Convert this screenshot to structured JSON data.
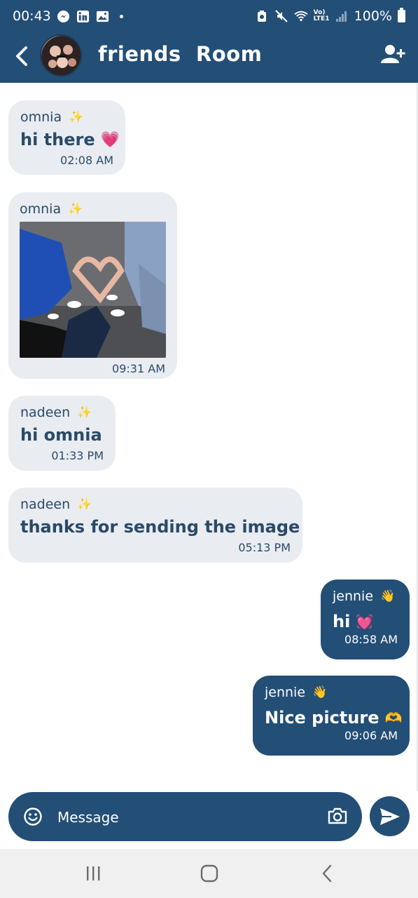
{
  "status_bar": {
    "time": "00:43",
    "battery": "100%",
    "network": "Vo) LTE1",
    "icons": [
      "messenger-icon",
      "linkedin-icon",
      "gallery-icon",
      "dot-icon",
      "mute-icon",
      "wifi-icon",
      "signal-icon",
      "battery-icon"
    ]
  },
  "header": {
    "title": "friends  Room",
    "back_icon": "chevron-left-icon",
    "add_user_icon": "add-user-icon"
  },
  "messages": [
    {
      "direction": "in",
      "sender": "omnia",
      "sender_emoji": "✨",
      "text": "hi there",
      "text_emoji": "💗",
      "time": "02:08 AM"
    },
    {
      "direction": "in",
      "sender": "omnia",
      "sender_emoji": "✨",
      "image": true,
      "time": "09:31 AM"
    },
    {
      "direction": "in",
      "sender": "nadeen",
      "sender_emoji": "✨",
      "text": "hi omnia",
      "time": "01:33 PM"
    },
    {
      "direction": "in",
      "sender": "nadeen",
      "sender_emoji": "✨",
      "text": "thanks for sending the image",
      "time": "05:13 PM"
    },
    {
      "direction": "out",
      "sender": "jennie",
      "sender_emoji": "👋",
      "text": "hi",
      "text_emoji": "💓",
      "time": "08:58 AM"
    },
    {
      "direction": "out",
      "sender": "jennie",
      "sender_emoji": "👋",
      "text": "Nice picture",
      "text_emoji": "🫶",
      "time": "09:06 AM"
    }
  ],
  "composer": {
    "placeholder": "Message",
    "emoji_icon": "smiley-icon",
    "camera_icon": "camera-icon",
    "send_icon": "send-icon"
  },
  "nav": {
    "icons": [
      "recent-apps-icon",
      "home-icon",
      "back-icon"
    ]
  },
  "colors": {
    "primary": "#234e76",
    "bubble_in": "#e9ecf1",
    "text_in": "#2a4a69"
  }
}
